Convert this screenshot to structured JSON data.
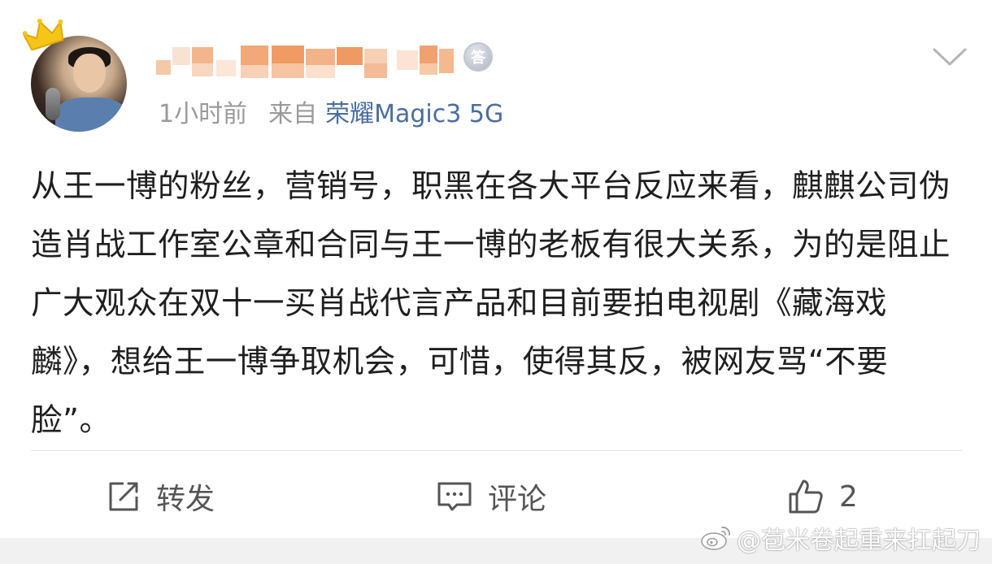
{
  "post": {
    "meta": {
      "time": "1小时前",
      "from_label": "来自",
      "device": "荣耀Magic3 5G"
    },
    "badge_text": "答",
    "content": "从王一博的粉丝，营销号，职黑在各大平台反应来看，麒麒公司伪造肖战工作室公章和合同与王一博的老板有很大关系，为的是阻止广大观众在双十一买肖战代言产品和目前要拍电视剧《藏海戏麟》，想给王一博争取机会，可惜，使得其反，被网友骂“不要脸”。"
  },
  "actions": {
    "repost_label": "转发",
    "comment_label": "评论",
    "like_count": "2"
  },
  "watermark": {
    "text": "@苞米卷起重来扛起刀"
  },
  "colors": {
    "accent_link": "#4a6da1",
    "meta_gray": "#9a9a9a",
    "body_text": "#1f1f1f"
  },
  "icons": [
    "crown-icon",
    "medal-badge-icon",
    "chevron-down-icon",
    "repost-icon",
    "comment-icon",
    "like-icon",
    "weibo-logo-icon"
  ]
}
